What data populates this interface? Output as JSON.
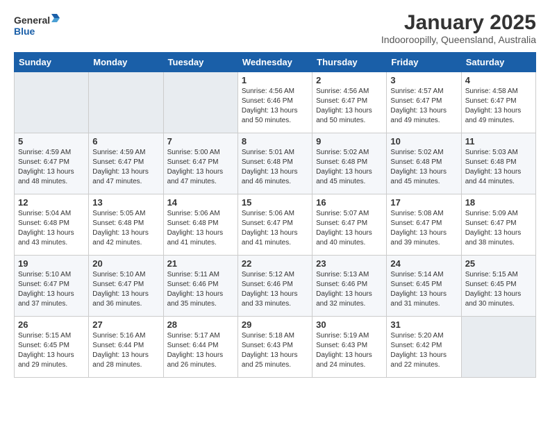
{
  "header": {
    "logo_line1": "General",
    "logo_line2": "Blue",
    "title": "January 2025",
    "subtitle": "Indooroopilly, Queensland, Australia"
  },
  "weekdays": [
    "Sunday",
    "Monday",
    "Tuesday",
    "Wednesday",
    "Thursday",
    "Friday",
    "Saturday"
  ],
  "weeks": [
    [
      {
        "day": "",
        "info": ""
      },
      {
        "day": "",
        "info": ""
      },
      {
        "day": "",
        "info": ""
      },
      {
        "day": "1",
        "info": "Sunrise: 4:56 AM\nSunset: 6:46 PM\nDaylight: 13 hours\nand 50 minutes."
      },
      {
        "day": "2",
        "info": "Sunrise: 4:56 AM\nSunset: 6:47 PM\nDaylight: 13 hours\nand 50 minutes."
      },
      {
        "day": "3",
        "info": "Sunrise: 4:57 AM\nSunset: 6:47 PM\nDaylight: 13 hours\nand 49 minutes."
      },
      {
        "day": "4",
        "info": "Sunrise: 4:58 AM\nSunset: 6:47 PM\nDaylight: 13 hours\nand 49 minutes."
      }
    ],
    [
      {
        "day": "5",
        "info": "Sunrise: 4:59 AM\nSunset: 6:47 PM\nDaylight: 13 hours\nand 48 minutes."
      },
      {
        "day": "6",
        "info": "Sunrise: 4:59 AM\nSunset: 6:47 PM\nDaylight: 13 hours\nand 47 minutes."
      },
      {
        "day": "7",
        "info": "Sunrise: 5:00 AM\nSunset: 6:47 PM\nDaylight: 13 hours\nand 47 minutes."
      },
      {
        "day": "8",
        "info": "Sunrise: 5:01 AM\nSunset: 6:48 PM\nDaylight: 13 hours\nand 46 minutes."
      },
      {
        "day": "9",
        "info": "Sunrise: 5:02 AM\nSunset: 6:48 PM\nDaylight: 13 hours\nand 45 minutes."
      },
      {
        "day": "10",
        "info": "Sunrise: 5:02 AM\nSunset: 6:48 PM\nDaylight: 13 hours\nand 45 minutes."
      },
      {
        "day": "11",
        "info": "Sunrise: 5:03 AM\nSunset: 6:48 PM\nDaylight: 13 hours\nand 44 minutes."
      }
    ],
    [
      {
        "day": "12",
        "info": "Sunrise: 5:04 AM\nSunset: 6:48 PM\nDaylight: 13 hours\nand 43 minutes."
      },
      {
        "day": "13",
        "info": "Sunrise: 5:05 AM\nSunset: 6:48 PM\nDaylight: 13 hours\nand 42 minutes."
      },
      {
        "day": "14",
        "info": "Sunrise: 5:06 AM\nSunset: 6:48 PM\nDaylight: 13 hours\nand 41 minutes."
      },
      {
        "day": "15",
        "info": "Sunrise: 5:06 AM\nSunset: 6:47 PM\nDaylight: 13 hours\nand 41 minutes."
      },
      {
        "day": "16",
        "info": "Sunrise: 5:07 AM\nSunset: 6:47 PM\nDaylight: 13 hours\nand 40 minutes."
      },
      {
        "day": "17",
        "info": "Sunrise: 5:08 AM\nSunset: 6:47 PM\nDaylight: 13 hours\nand 39 minutes."
      },
      {
        "day": "18",
        "info": "Sunrise: 5:09 AM\nSunset: 6:47 PM\nDaylight: 13 hours\nand 38 minutes."
      }
    ],
    [
      {
        "day": "19",
        "info": "Sunrise: 5:10 AM\nSunset: 6:47 PM\nDaylight: 13 hours\nand 37 minutes."
      },
      {
        "day": "20",
        "info": "Sunrise: 5:10 AM\nSunset: 6:47 PM\nDaylight: 13 hours\nand 36 minutes."
      },
      {
        "day": "21",
        "info": "Sunrise: 5:11 AM\nSunset: 6:46 PM\nDaylight: 13 hours\nand 35 minutes."
      },
      {
        "day": "22",
        "info": "Sunrise: 5:12 AM\nSunset: 6:46 PM\nDaylight: 13 hours\nand 33 minutes."
      },
      {
        "day": "23",
        "info": "Sunrise: 5:13 AM\nSunset: 6:46 PM\nDaylight: 13 hours\nand 32 minutes."
      },
      {
        "day": "24",
        "info": "Sunrise: 5:14 AM\nSunset: 6:45 PM\nDaylight: 13 hours\nand 31 minutes."
      },
      {
        "day": "25",
        "info": "Sunrise: 5:15 AM\nSunset: 6:45 PM\nDaylight: 13 hours\nand 30 minutes."
      }
    ],
    [
      {
        "day": "26",
        "info": "Sunrise: 5:15 AM\nSunset: 6:45 PM\nDaylight: 13 hours\nand 29 minutes."
      },
      {
        "day": "27",
        "info": "Sunrise: 5:16 AM\nSunset: 6:44 PM\nDaylight: 13 hours\nand 28 minutes."
      },
      {
        "day": "28",
        "info": "Sunrise: 5:17 AM\nSunset: 6:44 PM\nDaylight: 13 hours\nand 26 minutes."
      },
      {
        "day": "29",
        "info": "Sunrise: 5:18 AM\nSunset: 6:43 PM\nDaylight: 13 hours\nand 25 minutes."
      },
      {
        "day": "30",
        "info": "Sunrise: 5:19 AM\nSunset: 6:43 PM\nDaylight: 13 hours\nand 24 minutes."
      },
      {
        "day": "31",
        "info": "Sunrise: 5:20 AM\nSunset: 6:42 PM\nDaylight: 13 hours\nand 22 minutes."
      },
      {
        "day": "",
        "info": ""
      }
    ]
  ]
}
